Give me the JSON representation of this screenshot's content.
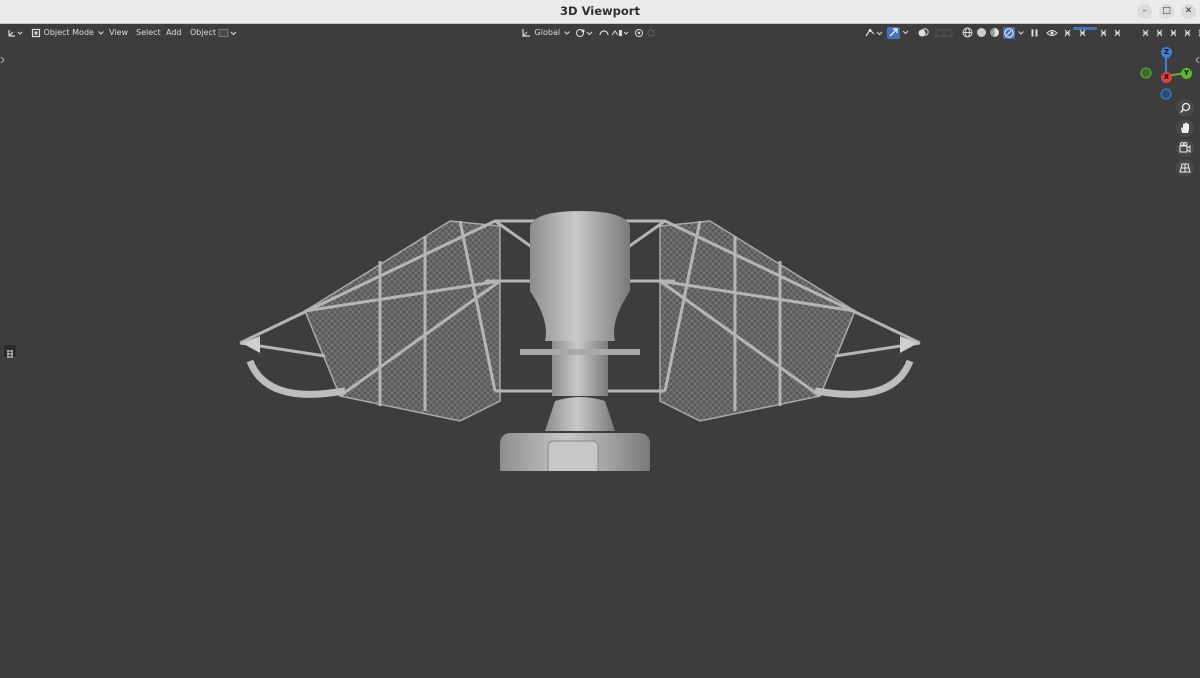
{
  "window": {
    "title": "3D Viewport",
    "min_label": "–",
    "max_label": "□",
    "close_label": "✕"
  },
  "header": {
    "mode": "Object Mode",
    "menus": [
      "View",
      "Select",
      "Add",
      "Object"
    ],
    "orientation": "Global"
  },
  "gizmo": {
    "z": "Z",
    "x": "X",
    "y": "Y"
  },
  "colors": {
    "gizmo_x": "#e0413e",
    "gizmo_y": "#5cb82f",
    "gizmo_z": "#3a82d8",
    "accent": "#4772b3"
  },
  "icons": [
    "editor-type-icon",
    "object-mode-icon",
    "transform-pivot-icon",
    "snap-icon",
    "proportional-edit-icon",
    "visibility-icon",
    "gizmo-toggle-icon",
    "overlay-icon",
    "xray-icon",
    "wireframe-shading-icon",
    "solid-shading-icon",
    "material-shading-icon",
    "rendered-shading-icon",
    "zoom-icon",
    "pan-hand-icon",
    "camera-view-icon",
    "perspective-toggle-icon"
  ]
}
